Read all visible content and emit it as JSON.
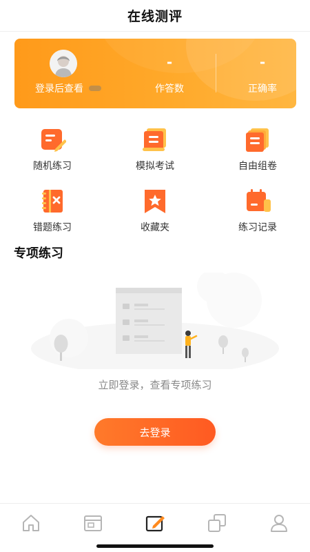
{
  "header": {
    "title": "在线测评"
  },
  "stats": {
    "login_prompt": "登录后查看",
    "answers": {
      "value": "-",
      "label": "作答数"
    },
    "accuracy": {
      "value": "-",
      "label": "正确率"
    }
  },
  "features": [
    {
      "label": "随机练习",
      "icon": "note-pencil-icon"
    },
    {
      "label": "模拟考试",
      "icon": "scroll-icon"
    },
    {
      "label": "自由组卷",
      "icon": "stacked-papers-icon"
    },
    {
      "label": "错题练习",
      "icon": "wrong-question-book-icon"
    },
    {
      "label": "收藏夹",
      "icon": "bookmark-star-icon"
    },
    {
      "label": "练习记录",
      "icon": "calendar-record-icon"
    }
  ],
  "section": {
    "title": "专项练习"
  },
  "empty_state": {
    "message": "立即登录，查看专项练习",
    "button_label": "去登录"
  },
  "tabbar": {
    "items": [
      {
        "icon": "home-icon",
        "active": false
      },
      {
        "icon": "browser-window-icon",
        "active": false
      },
      {
        "icon": "edit-test-icon",
        "active": true
      },
      {
        "icon": "copy-squares-icon",
        "active": false
      },
      {
        "icon": "user-icon",
        "active": false
      }
    ]
  },
  "colors": {
    "accent": "#ff9a1a",
    "button": "#ff5a22",
    "icon_orange": "#ff6a2c",
    "icon_yellow": "#ffc24a"
  }
}
